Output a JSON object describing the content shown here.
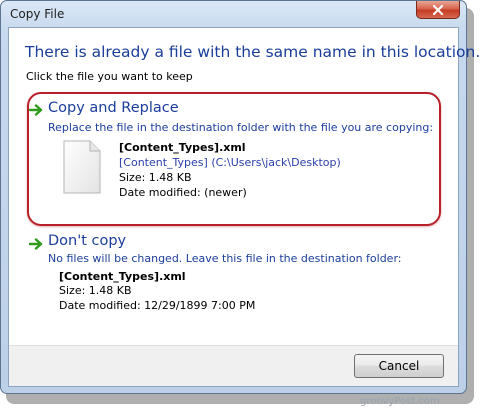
{
  "window": {
    "title": "Copy File"
  },
  "dialog": {
    "heading": "There is already a file with the same name in this location.",
    "instruction": "Click the file you want to keep"
  },
  "option_replace": {
    "title": "Copy and Replace",
    "description": "Replace the file in the destination folder with the file you are copying:",
    "file_name": "[Content_Types].xml",
    "file_path": "[Content_Types] (C:\\Users\\jack\\Desktop)",
    "size": "Size: 1.48 KB",
    "modified": "Date modified:  (newer)"
  },
  "option_skip": {
    "title": "Don't copy",
    "description": "No files will be changed. Leave this file in the destination folder:",
    "file_name": "[Content_Types].xml",
    "size": "Size: 1.48 KB",
    "modified": "Date modified: 12/29/1899 7:00 PM"
  },
  "buttons": {
    "cancel": "Cancel"
  },
  "watermark": "groovyPost.com",
  "colors": {
    "accent_text": "#1b3e9a",
    "highlight_border": "#b8202a",
    "arrow_green": "#2f9a1e"
  }
}
